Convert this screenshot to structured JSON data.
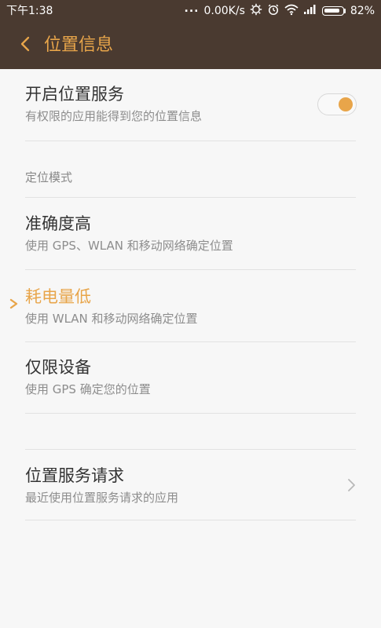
{
  "status_bar": {
    "time": "下午1:38",
    "net_speed": "0.00K/s",
    "battery": "82%"
  },
  "header": {
    "title": "位置信息"
  },
  "location_service": {
    "title": "开启位置服务",
    "subtitle": "有权限的应用能得到您的位置信息",
    "enabled": true,
    "accent": "#e8a54a"
  },
  "mode_section": {
    "label": "定位模式",
    "options": [
      {
        "title": "准确度高",
        "subtitle": "使用 GPS、WLAN 和移动网络确定位置",
        "selected": false
      },
      {
        "title": "耗电量低",
        "subtitle": "使用 WLAN 和移动网络确定位置",
        "selected": true
      },
      {
        "title": "仅限设备",
        "subtitle": "使用 GPS 确定您的位置",
        "selected": false
      }
    ]
  },
  "requests": {
    "title": "位置服务请求",
    "subtitle": "最近使用位置服务请求的应用"
  }
}
